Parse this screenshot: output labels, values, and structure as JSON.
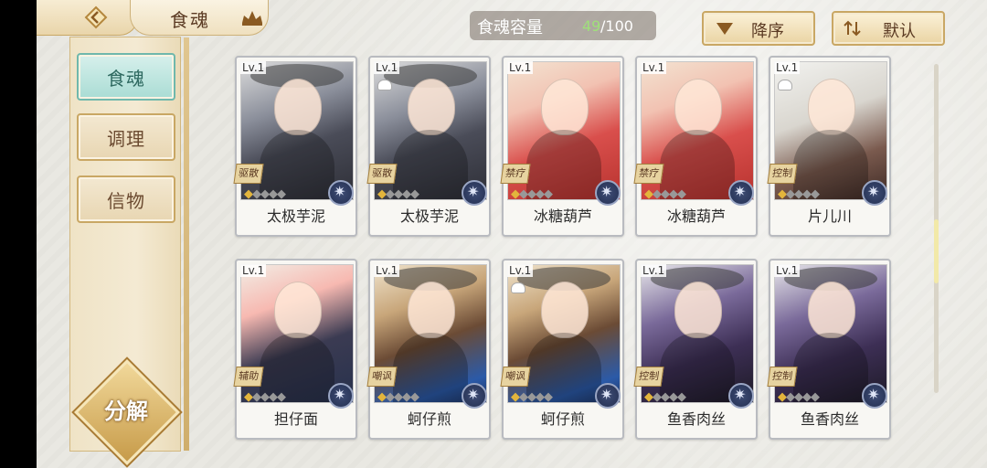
{
  "header": {
    "title": "食魂",
    "capacity_label": "食魂容量",
    "capacity_count": "49",
    "capacity_max": "/100",
    "sort_label": "降序",
    "default_label": "默认"
  },
  "sidebar": {
    "items": [
      {
        "label": "食魂"
      },
      {
        "label": "调理"
      },
      {
        "label": "信物"
      }
    ],
    "decompose_label": "分解"
  },
  "cards": [
    {
      "level": "Lv.1",
      "role": "驱散",
      "name": "太极芋泥",
      "stars_on": 1,
      "stars_total": 5,
      "locked": false
    },
    {
      "level": "Lv.1",
      "role": "驱散",
      "name": "太极芋泥",
      "stars_on": 1,
      "stars_total": 5,
      "locked": true
    },
    {
      "level": "Lv.1",
      "role": "禁疗",
      "name": "冰糖葫芦",
      "stars_on": 1,
      "stars_total": 5,
      "locked": false
    },
    {
      "level": "Lv.1",
      "role": "禁疗",
      "name": "冰糖葫芦",
      "stars_on": 1,
      "stars_total": 5,
      "locked": false
    },
    {
      "level": "Lv.1",
      "role": "控制",
      "name": "片儿川",
      "stars_on": 1,
      "stars_total": 5,
      "locked": true
    },
    {
      "level": "Lv.1",
      "role": "辅助",
      "name": "担仔面",
      "stars_on": 1,
      "stars_total": 5,
      "locked": false
    },
    {
      "level": "Lv.1",
      "role": "嘲讽",
      "name": "蚵仔煎",
      "stars_on": 1,
      "stars_total": 5,
      "locked": false
    },
    {
      "level": "Lv.1",
      "role": "嘲讽",
      "name": "蚵仔煎",
      "stars_on": 1,
      "stars_total": 5,
      "locked": true
    },
    {
      "level": "Lv.1",
      "role": "控制",
      "name": "鱼香肉丝",
      "stars_on": 1,
      "stars_total": 5,
      "locked": false
    },
    {
      "level": "Lv.1",
      "role": "控制",
      "name": "鱼香肉丝",
      "stars_on": 1,
      "stars_total": 5,
      "locked": false
    }
  ],
  "colors": {
    "accent_teal": "#a9dcd4",
    "gold": "#c9a764",
    "capacity_green": "#9fe07a"
  }
}
